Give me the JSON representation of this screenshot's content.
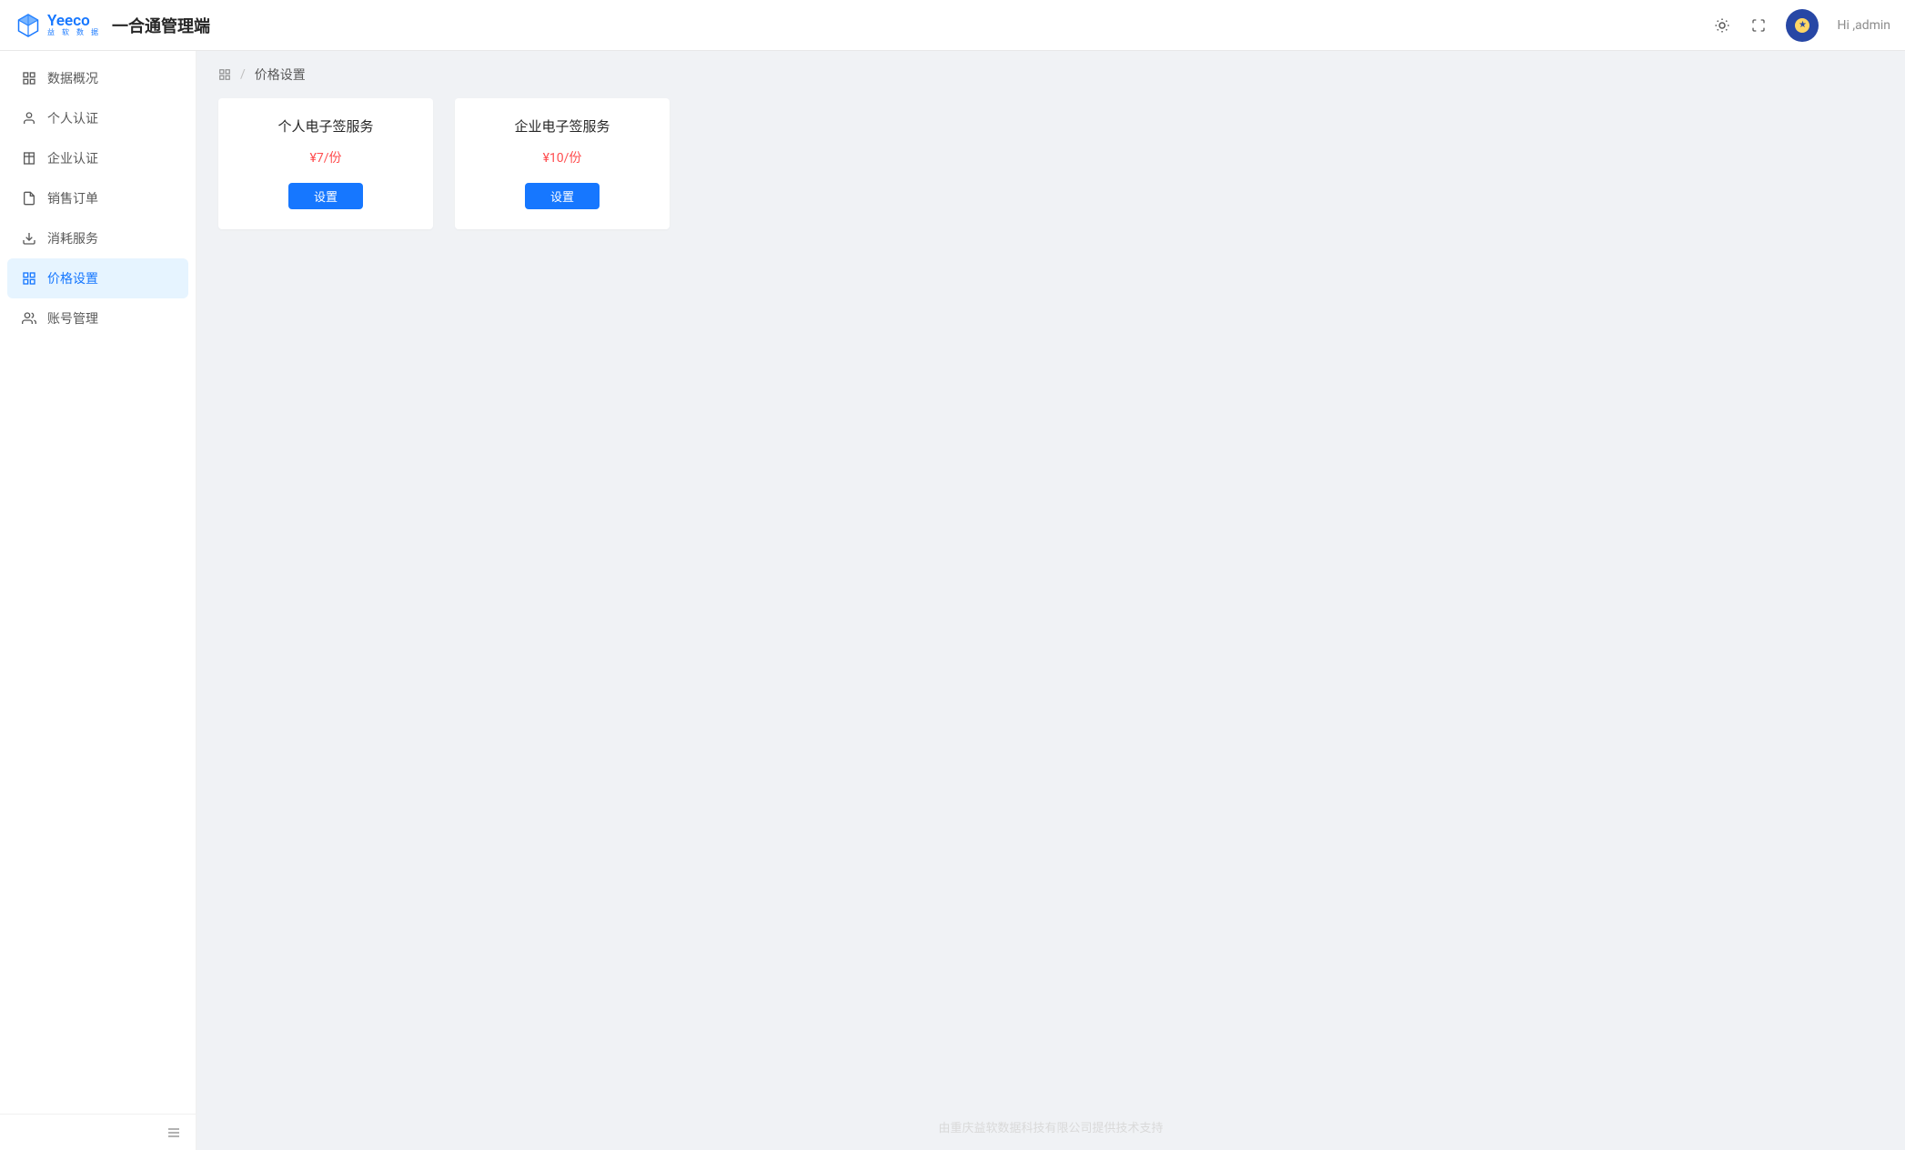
{
  "header": {
    "brand_name": "Yeeco",
    "brand_sub": "益 软 数 据",
    "app_title": "一合通管理端",
    "greeting": "Hi ,admin"
  },
  "sidebar": {
    "items": [
      {
        "label": "数据概况",
        "name": "data-overview",
        "icon": "grid"
      },
      {
        "label": "个人认证",
        "name": "personal-auth",
        "icon": "user"
      },
      {
        "label": "企业认证",
        "name": "enterprise-auth",
        "icon": "building"
      },
      {
        "label": "销售订单",
        "name": "sales-orders",
        "icon": "file"
      },
      {
        "label": "消耗服务",
        "name": "consumption-service",
        "icon": "download"
      },
      {
        "label": "价格设置",
        "name": "price-settings",
        "icon": "grid",
        "active": true
      },
      {
        "label": "账号管理",
        "name": "account-management",
        "icon": "users"
      }
    ]
  },
  "breadcrumb": {
    "separator": "/",
    "current": "价格设置"
  },
  "cards": [
    {
      "title": "个人电子签服务",
      "price": "¥7/份",
      "button_label": "设置"
    },
    {
      "title": "企业电子签服务",
      "price": "¥10/份",
      "button_label": "设置"
    }
  ],
  "footer": {
    "text": "由重庆益软数据科技有限公司提供技术支持"
  }
}
